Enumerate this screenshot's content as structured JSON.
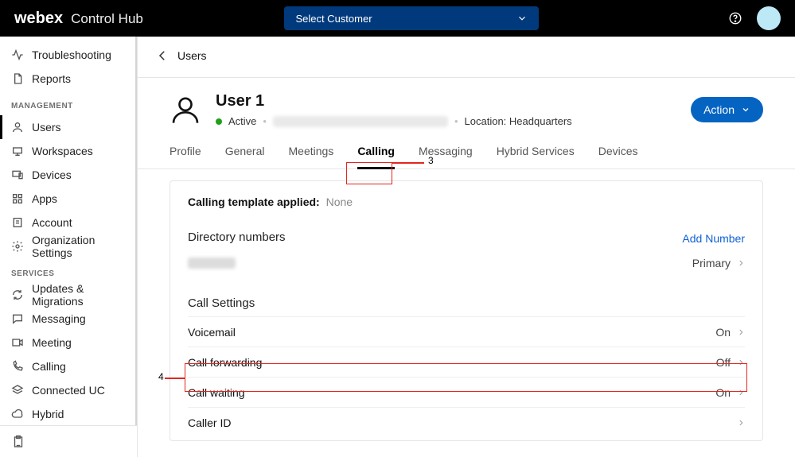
{
  "topbar": {
    "brand_main": "webex",
    "brand_sub": "Control Hub",
    "customer_select_label": "Select Customer"
  },
  "sidebar": {
    "monitoring": {
      "items": [
        {
          "key": "troubleshooting",
          "label": "Troubleshooting"
        },
        {
          "key": "reports",
          "label": "Reports"
        }
      ]
    },
    "management": {
      "heading": "MANAGEMENT",
      "items": [
        {
          "key": "users",
          "label": "Users",
          "active": true
        },
        {
          "key": "workspaces",
          "label": "Workspaces"
        },
        {
          "key": "devices",
          "label": "Devices"
        },
        {
          "key": "apps",
          "label": "Apps"
        },
        {
          "key": "account",
          "label": "Account"
        },
        {
          "key": "org",
          "label": "Organization Settings"
        }
      ]
    },
    "services": {
      "heading": "SERVICES",
      "items": [
        {
          "key": "updates",
          "label": "Updates & Migrations"
        },
        {
          "key": "messaging",
          "label": "Messaging"
        },
        {
          "key": "meeting",
          "label": "Meeting"
        },
        {
          "key": "calling",
          "label": "Calling"
        },
        {
          "key": "connected-uc",
          "label": "Connected UC"
        },
        {
          "key": "hybrid",
          "label": "Hybrid"
        }
      ]
    }
  },
  "breadcrumb": {
    "back_label": "Users"
  },
  "user": {
    "name": "User 1",
    "status": "Active",
    "location_label": "Location: Headquarters",
    "action_button": "Action"
  },
  "tabs": [
    {
      "key": "profile",
      "label": "Profile"
    },
    {
      "key": "general",
      "label": "General"
    },
    {
      "key": "meetings",
      "label": "Meetings"
    },
    {
      "key": "calling",
      "label": "Calling",
      "active": true
    },
    {
      "key": "messaging",
      "label": "Messaging"
    },
    {
      "key": "hybrid",
      "label": "Hybrid Services"
    },
    {
      "key": "devices",
      "label": "Devices"
    }
  ],
  "calling_panel": {
    "template_label": "Calling template applied:",
    "template_value": "None",
    "directory": {
      "heading": "Directory numbers",
      "add_label": "Add Number",
      "rows": [
        {
          "tag": "Primary"
        }
      ]
    },
    "call_settings": {
      "heading": "Call Settings",
      "rows": [
        {
          "label": "Voicemail",
          "value": "On"
        },
        {
          "label": "Call forwarding",
          "value": "Off"
        },
        {
          "label": "Call waiting",
          "value": "On"
        },
        {
          "label": "Caller ID",
          "value": ""
        }
      ]
    }
  },
  "annotations": {
    "tab_num": "3",
    "row_num": "4"
  }
}
